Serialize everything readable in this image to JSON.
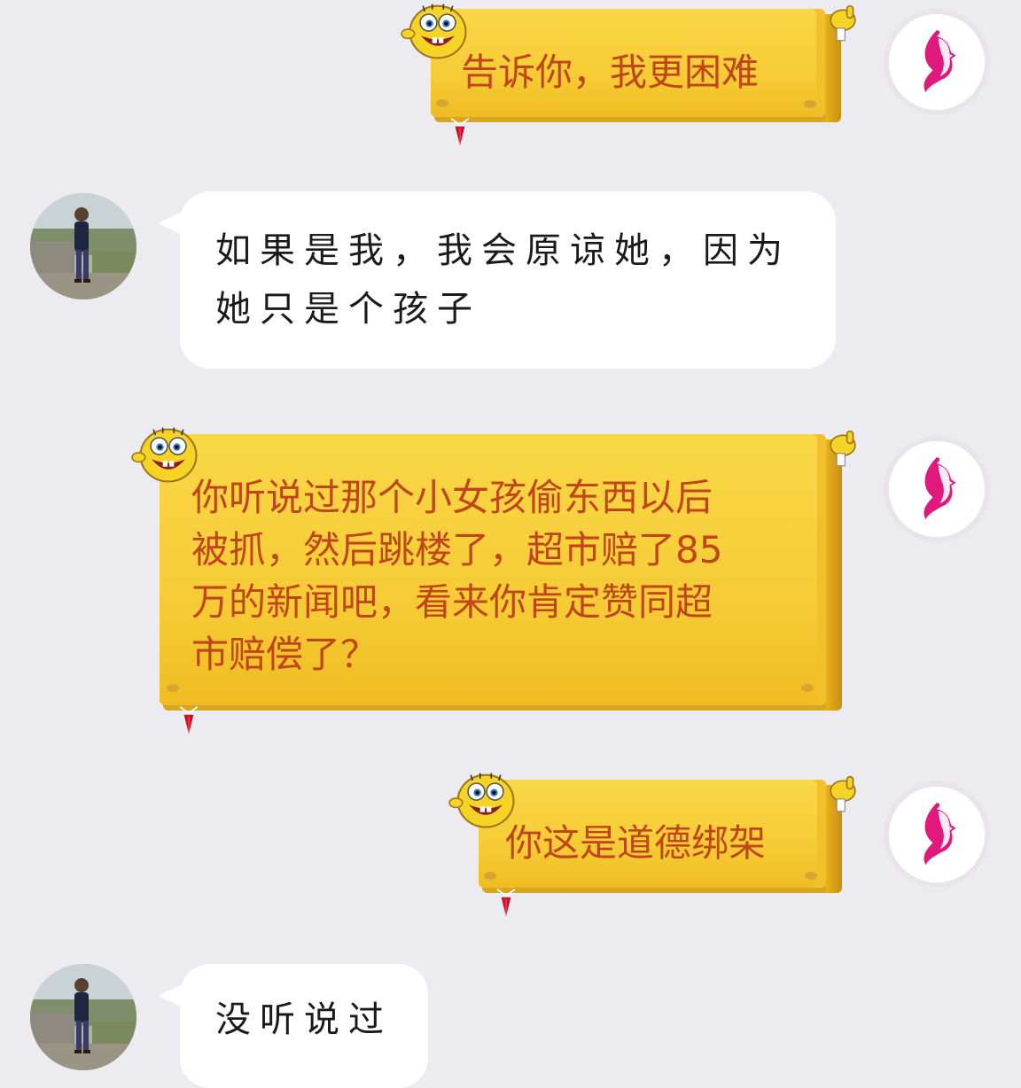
{
  "messages": [
    {
      "sender": "self",
      "text": "告诉你，我更困难"
    },
    {
      "sender": "other",
      "text": "如果是我，我会原谅她，因为\n她只是个孩子"
    },
    {
      "sender": "self",
      "text": "你听说过那个小女孩偷东西以后\n被抓，然后跳楼了，超市赔了85\n万的新闻吧，看来你肯定赞同超\n市赔偿了？"
    },
    {
      "sender": "self",
      "text": "你这是道德绑架"
    },
    {
      "sender": "other",
      "text": "没听说过"
    }
  ],
  "colors": {
    "background": "#ebebf0",
    "bubble_yellow": "#f6cc36",
    "bubble_text_red": "#c0461a",
    "bubble_white": "#ffffff",
    "self_avatar_accent": "#e0197c"
  },
  "icons": {
    "self_avatar": "pink-face-profile-logo",
    "other_avatar": "person-photo",
    "bubble_decoration": "sponge-character-icon",
    "bubble_tassel": "red-tassel-icon"
  }
}
